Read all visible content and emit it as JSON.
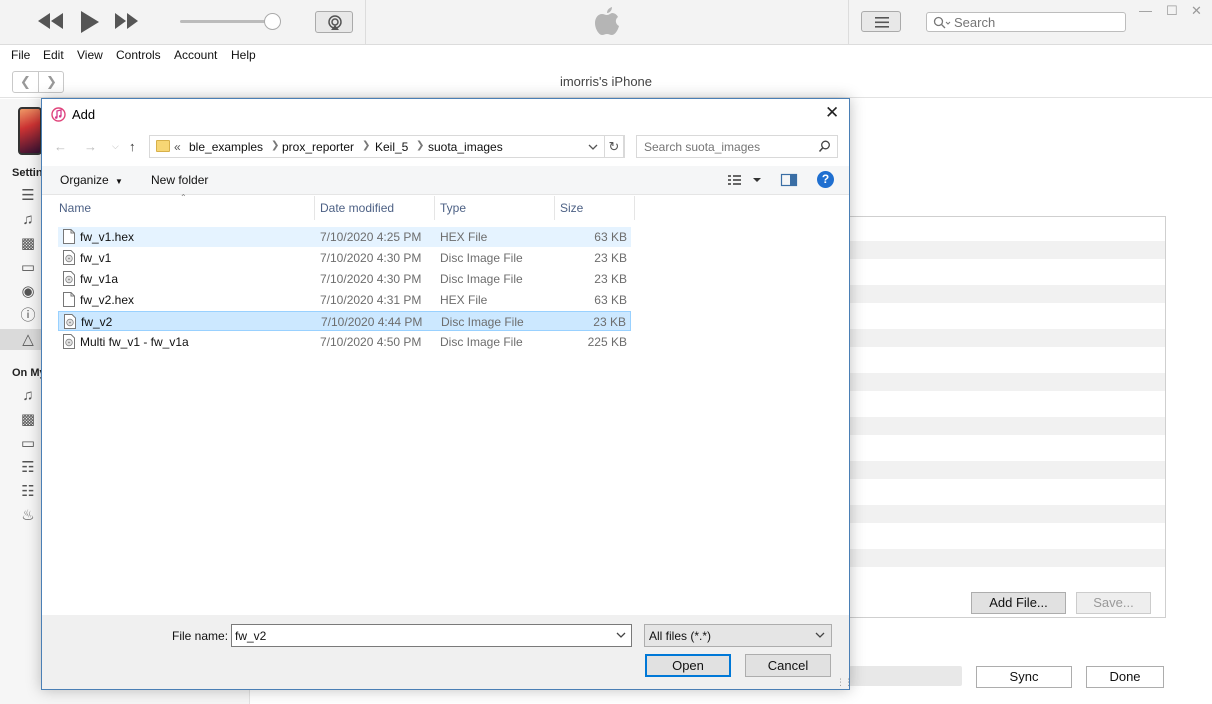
{
  "itunes": {
    "search_placeholder": "Search",
    "menu": [
      "File",
      "Edit",
      "View",
      "Controls",
      "Account",
      "Help"
    ],
    "device_title": "imorris's iPhone",
    "sidebar": {
      "settings_label": "Settin",
      "on_my_device_label": "On My"
    },
    "file_panel": {
      "add_file_label": "Add File...",
      "save_label": "Save..."
    },
    "sync_label": "Sync",
    "done_label": "Done"
  },
  "dialog": {
    "title": "Add",
    "breadcrumb_prefix": "«",
    "breadcrumbs": [
      "ble_examples",
      "prox_reporter",
      "Keil_5",
      "suota_images"
    ],
    "search_placeholder": "Search suota_images",
    "organize_label": "Organize",
    "new_folder_label": "New folder",
    "columns": {
      "name": "Name",
      "date": "Date modified",
      "type": "Type",
      "size": "Size"
    },
    "files": [
      {
        "name": "fw_v1.hex",
        "date": "7/10/2020 4:25 PM",
        "type": "HEX File",
        "size": "63 KB",
        "state": "hover",
        "icon": "document-icon"
      },
      {
        "name": "fw_v1",
        "date": "7/10/2020 4:30 PM",
        "type": "Disc Image File",
        "size": "23 KB",
        "state": "",
        "icon": "disc-image-icon"
      },
      {
        "name": "fw_v1a",
        "date": "7/10/2020 4:30 PM",
        "type": "Disc Image File",
        "size": "23 KB",
        "state": "",
        "icon": "disc-image-icon"
      },
      {
        "name": "fw_v2.hex",
        "date": "7/10/2020 4:31 PM",
        "type": "HEX File",
        "size": "63 KB",
        "state": "",
        "icon": "document-icon"
      },
      {
        "name": "fw_v2",
        "date": "7/10/2020 4:44 PM",
        "type": "Disc Image File",
        "size": "23 KB",
        "state": "selected",
        "icon": "disc-image-icon"
      },
      {
        "name": "Multi fw_v1 - fw_v1a",
        "date": "7/10/2020 4:50 PM",
        "type": "Disc Image File",
        "size": "225 KB",
        "state": "",
        "icon": "disc-image-icon"
      }
    ],
    "file_name_label": "File name:",
    "file_name_value": "fw_v2",
    "file_type_value": "All files (*.*)",
    "open_label": "Open",
    "cancel_label": "Cancel"
  },
  "colors": {
    "selection": "#cce8ff",
    "hover": "#e5f3ff",
    "primary_border": "#0078d7",
    "help_blue": "#1f6fd0"
  }
}
